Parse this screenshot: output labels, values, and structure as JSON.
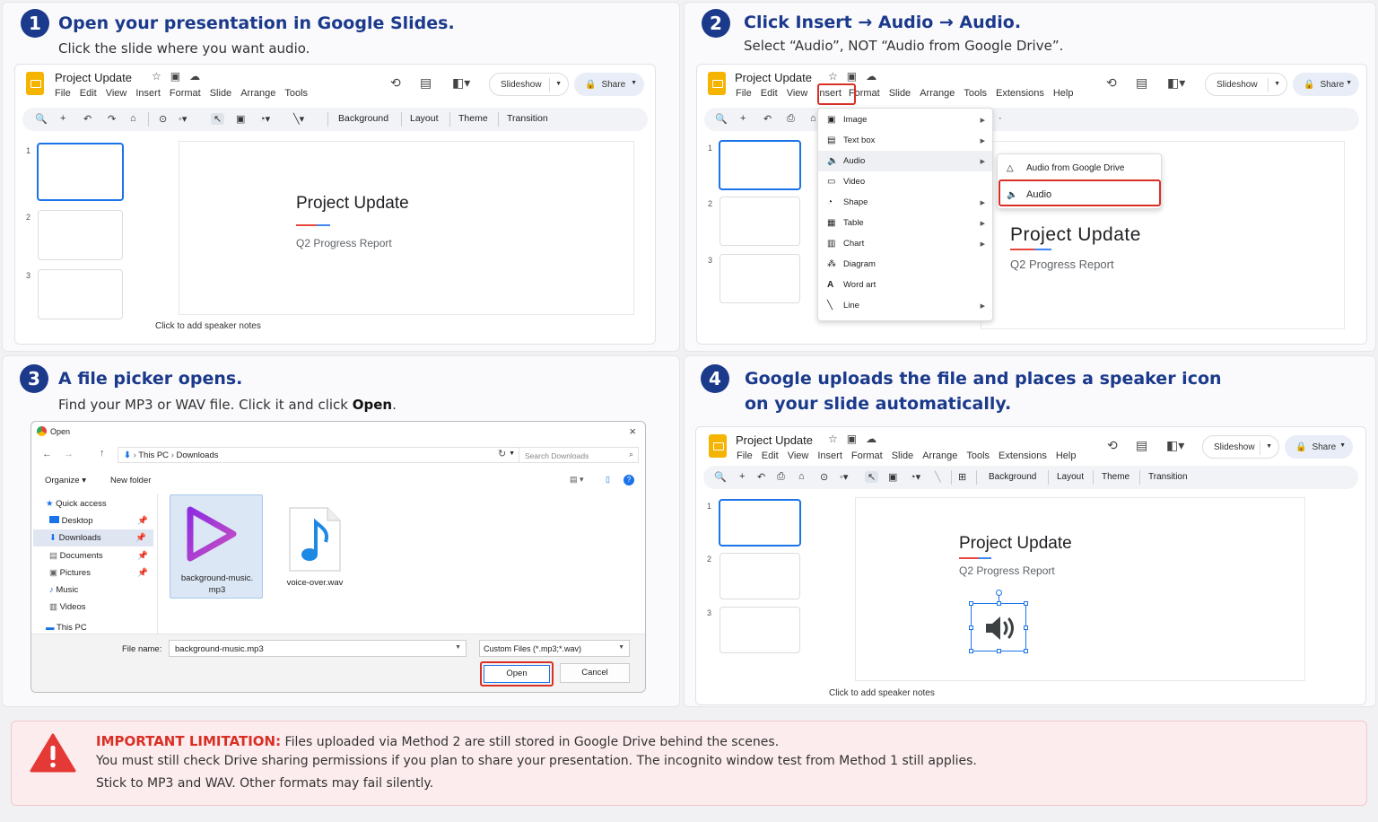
{
  "colors": {
    "step_badge": "#1b3a8c",
    "accent_red": "#d93025",
    "selection_blue": "#1a73e8"
  },
  "common": {
    "doc_title": "Project Update",
    "slide_title": "Project Update",
    "slide_subtitle": "Q2 Progress Report",
    "notes": "Click to add speaker notes",
    "slideshow": "Slideshow",
    "share": "Share",
    "slide_numbers": [
      "1",
      "2",
      "3"
    ]
  },
  "step1": {
    "num": "1",
    "title": "Open your presentation in Google Slides.",
    "subtitle": "Click the slide where you want audio.",
    "menus": [
      "File",
      "Edit",
      "View",
      "Insert",
      "Format",
      "Slide",
      "Arrange",
      "Tools"
    ],
    "toolbar": [
      "Background",
      "Layout",
      "Theme",
      "Transition"
    ]
  },
  "step2": {
    "num": "2",
    "title": "Click Insert → Audio → Audio.",
    "subtitle": "Select “Audio”, NOT “Audio from Google Drive”.",
    "menus": [
      "File",
      "Edit",
      "View",
      "Insert",
      "Format",
      "Slide",
      "Arrange",
      "Tools",
      "Extensions",
      "Help"
    ],
    "insert_items": [
      {
        "icon": "image-icon",
        "glyph": "▣",
        "label": "Image",
        "sub": true
      },
      {
        "icon": "textbox-icon",
        "glyph": "▤",
        "label": "Text box",
        "sub": true
      },
      {
        "icon": "audio-icon",
        "glyph": "🔈",
        "label": "Audio",
        "sub": true
      },
      {
        "icon": "video-icon",
        "glyph": "▭",
        "label": "Video",
        "sub": false
      },
      {
        "icon": "shape-icon",
        "glyph": "◔",
        "label": "Shape",
        "sub": true
      },
      {
        "icon": "table-icon",
        "glyph": "▦",
        "label": "Table",
        "sub": true
      },
      {
        "icon": "chart-icon",
        "glyph": "▥",
        "label": "Chart",
        "sub": true
      },
      {
        "icon": "diagram-icon",
        "glyph": "⁂",
        "label": "Diagram",
        "sub": false
      },
      {
        "icon": "wordart-icon",
        "glyph": "A",
        "label": "Word art",
        "sub": false
      },
      {
        "icon": "line-icon",
        "glyph": "╲",
        "label": "Line",
        "sub": true
      }
    ],
    "audio_sub": [
      "Audio from Google Drive",
      "Audio"
    ]
  },
  "step3": {
    "num": "3",
    "title": "A file picker opens.",
    "subtitle_pre": "Find your MP3 or WAV file. Click it and click ",
    "subtitle_bold": "Open",
    "subtitle_post": ".",
    "window_title": "Open",
    "path": [
      "This PC",
      "Downloads"
    ],
    "search_placeholder": "Search Downloads",
    "organize": "Organize",
    "new_folder": "New folder",
    "nav": [
      "Quick access",
      "Desktop",
      "Downloads",
      "Documents",
      "Pictures",
      "Music",
      "Videos",
      "This PC"
    ],
    "files": [
      {
        "name": "background-music.mp3"
      },
      {
        "name": "voice-over.wav"
      }
    ],
    "file_name_label": "File name:",
    "file_name_value": "background-music.mp3",
    "filter": "Custom Files (*.mp3;*.wav)",
    "open": "Open",
    "cancel": "Cancel"
  },
  "step4": {
    "num": "4",
    "title_l1": "Google uploads the file and places a speaker icon",
    "title_l2": "on your slide automatically.",
    "menus": [
      "File",
      "Edit",
      "View",
      "Insert",
      "Format",
      "Slide",
      "Arrange",
      "Tools",
      "Extensions",
      "Help"
    ],
    "toolbar": [
      "Background",
      "Layout",
      "Theme",
      "Transition"
    ]
  },
  "warning": {
    "label": "IMPORTANT LIMITATION:",
    "line1": " Files uploaded via Method 2 are still stored in Google Drive behind the scenes.",
    "line2": "You must still check Drive sharing permissions if you plan to share your presentation. The incognito window test from Method 1 still applies.",
    "line3": "Stick to MP3 and WAV. Other formats may fail silently."
  }
}
